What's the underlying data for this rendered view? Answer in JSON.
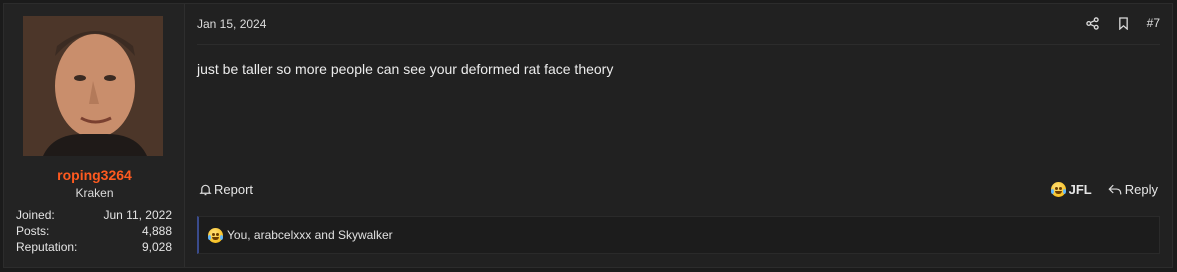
{
  "user": {
    "username": "roping3264",
    "title": "Kraken",
    "stats": [
      {
        "label": "Joined:",
        "value": "Jun 11, 2022"
      },
      {
        "label": "Posts:",
        "value": "4,888"
      },
      {
        "label": "Reputation:",
        "value": "9,028"
      }
    ]
  },
  "post": {
    "date": "Jan 15, 2024",
    "number": "#7",
    "body": "just be taller so more people can see your deformed rat face theory"
  },
  "actions": {
    "report_label": "Report",
    "react_label": "JFL",
    "reply_label": "Reply"
  },
  "reactions": {
    "summary": "You, arabcelxxx and Skywalker"
  },
  "colors": {
    "username": "#ff5a1f",
    "background": "#212121",
    "reaction_accent": "#3a4b8c"
  }
}
